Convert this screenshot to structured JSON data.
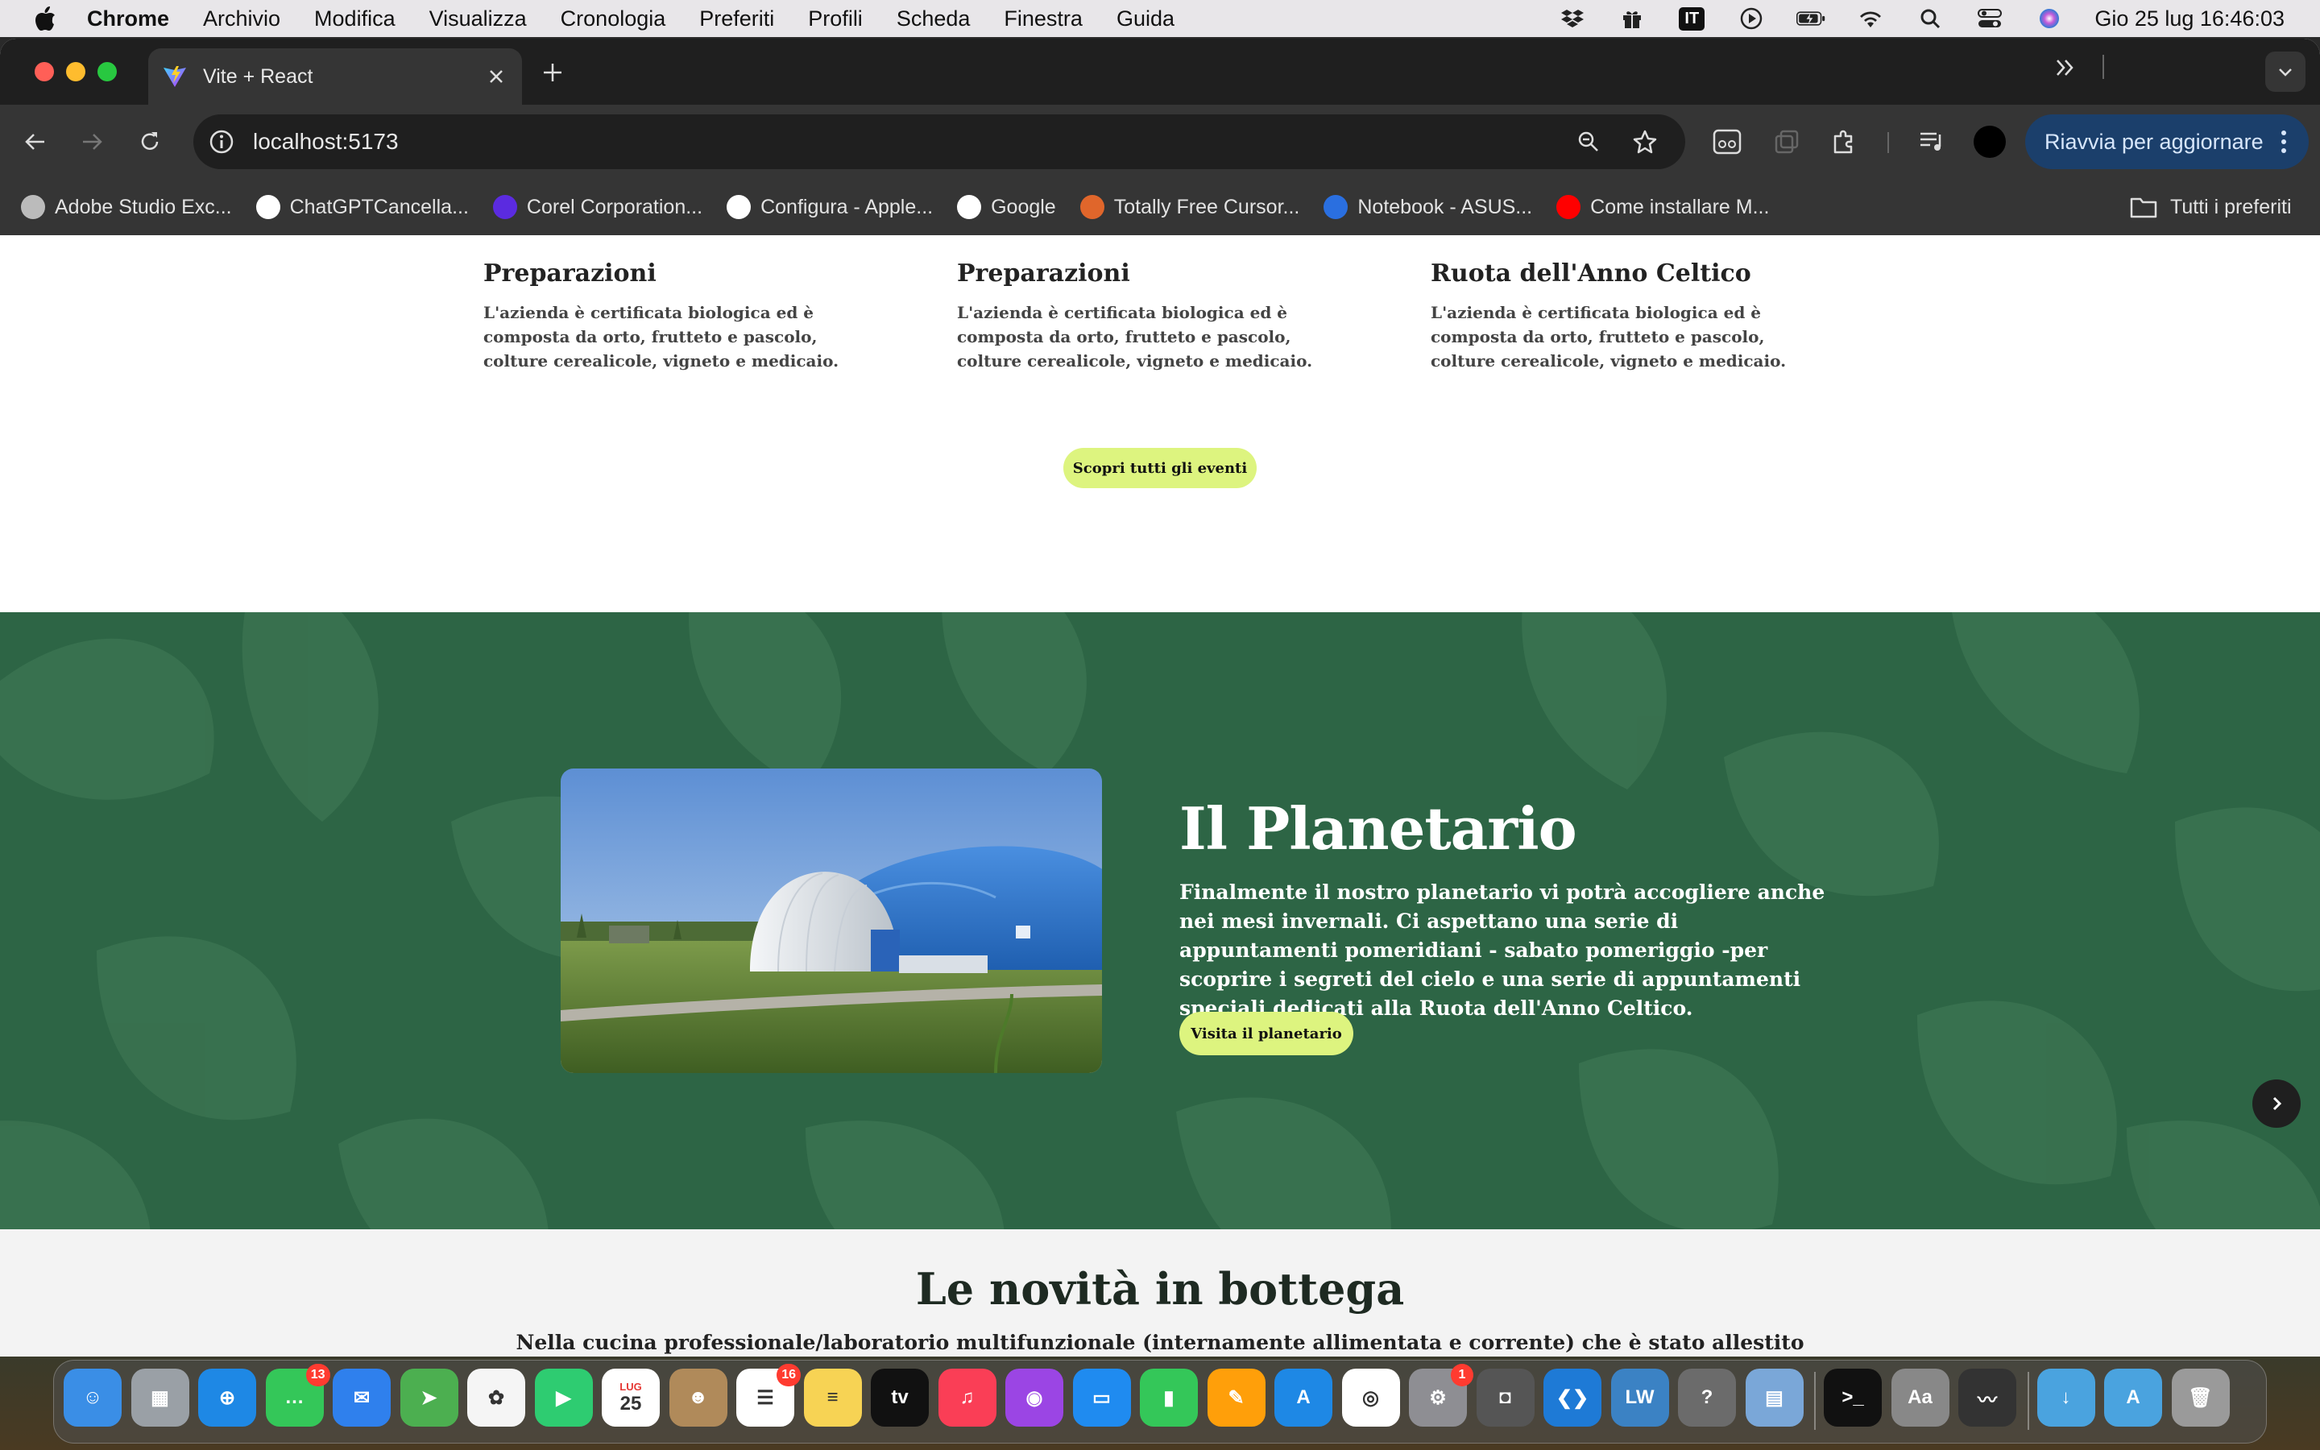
{
  "menubar": {
    "app_name": "Chrome",
    "items": [
      "Archivio",
      "Modifica",
      "Visualizza",
      "Cronologia",
      "Preferiti",
      "Profili",
      "Scheda",
      "Finestra",
      "Guida"
    ],
    "input_source": "IT",
    "clock": "Gio 25 lug  16:46:03"
  },
  "browser": {
    "tab_title": "Vite + React",
    "url": "localhost:5173",
    "relaunch_label": "Riavvia per aggiornare",
    "bookmarks": [
      {
        "label": "Adobe Studio Exc...",
        "icon": "globe-icon",
        "color": "#bbbbbb"
      },
      {
        "label": "ChatGPTCancella...",
        "icon": "chatgpt-icon",
        "color": "#ffffff"
      },
      {
        "label": "Corel Corporation...",
        "icon": "corel-icon",
        "color": "#5b2be0"
      },
      {
        "label": "Configura - Apple...",
        "icon": "apple-icon",
        "color": "#ffffff"
      },
      {
        "label": "Google",
        "icon": "google-icon",
        "color": "#ffffff"
      },
      {
        "label": "Totally Free Cursor...",
        "icon": "cursor-icon",
        "color": "#e0662b"
      },
      {
        "label": "Notebook - ASUS...",
        "icon": "asus-icon",
        "color": "#2a6fe0"
      },
      {
        "label": "Come installare M...",
        "icon": "youtube-icon",
        "color": "#ff0000"
      }
    ],
    "all_bookmarks_label": "Tutti i preferiti"
  },
  "page": {
    "events": [
      {
        "title": "Preparazioni",
        "text": "L'azienda è certificata biologica ed è composta da orto, frutteto e pascolo, colture cerealicole, vigneto e medicaio."
      },
      {
        "title": "Preparazioni",
        "text": "L'azienda è certificata biologica ed è composta da orto, frutteto e pascolo, colture cerealicole, vigneto e medicaio."
      },
      {
        "title": "Ruota dell'Anno Celtico",
        "text": "L'azienda è certificata biologica ed è composta da orto, frutteto e pascolo, colture cerealicole, vigneto e medicaio."
      }
    ],
    "events_button": "Scopri tutti gli eventi",
    "planetario": {
      "title": "Il Planetario",
      "text": "Finalmente il nostro planetario vi potrà accogliere anche nei mesi invernali. Ci aspettano una serie di appuntamenti pomeridiani - sabato pomeriggio -per scoprire i segreti del cielo e una serie di appuntamenti speciali dedicati alla Ruota dell'Anno Celtico.",
      "button": "Visita il planetario"
    },
    "bottega": {
      "title": "Le novità in bottega",
      "text": "Nella cucina professionale/laboratorio multifunzionale (internamente allimentata e corrente) che è stato allestito"
    }
  },
  "dock": {
    "apps": [
      {
        "name": "finder",
        "color": "#3a8ee6",
        "glyph": "☺"
      },
      {
        "name": "launchpad",
        "color": "#9aa0a6",
        "glyph": "▦"
      },
      {
        "name": "safari",
        "color": "#1e88e5",
        "glyph": "⊕"
      },
      {
        "name": "messages",
        "color": "#34c759",
        "glyph": "…",
        "badge": "13"
      },
      {
        "name": "mail",
        "color": "#2f80ed",
        "glyph": "✉"
      },
      {
        "name": "maps",
        "color": "#4caf50",
        "glyph": "➤"
      },
      {
        "name": "photos",
        "color": "#f5f5f5",
        "glyph": "✿"
      },
      {
        "name": "facetime",
        "color": "#2ecc71",
        "glyph": "▶"
      },
      {
        "name": "calendar",
        "color": "#ffffff",
        "glyph": "25",
        "caption": "LUG"
      },
      {
        "name": "contacts",
        "color": "#b08a5a",
        "glyph": "☻"
      },
      {
        "name": "reminders",
        "color": "#ffffff",
        "glyph": "☰",
        "badge": "16"
      },
      {
        "name": "notes",
        "color": "#f7d354",
        "glyph": "≡"
      },
      {
        "name": "apple-tv",
        "color": "#111111",
        "glyph": "tv"
      },
      {
        "name": "music",
        "color": "#fa3e56",
        "glyph": "♫"
      },
      {
        "name": "podcasts",
        "color": "#9b45e4",
        "glyph": "◉"
      },
      {
        "name": "keynote",
        "color": "#1f8bf0",
        "glyph": "▭"
      },
      {
        "name": "numbers",
        "color": "#34c759",
        "glyph": "▮"
      },
      {
        "name": "pages",
        "color": "#ff9f0a",
        "glyph": "✎"
      },
      {
        "name": "app-store",
        "color": "#1e88e5",
        "glyph": "A"
      },
      {
        "name": "chrome",
        "color": "#ffffff",
        "glyph": "◎"
      },
      {
        "name": "system-settings",
        "color": "#8e8e93",
        "glyph": "⚙",
        "badge": "1"
      },
      {
        "name": "screenshot",
        "color": "#555555",
        "glyph": "◘"
      },
      {
        "name": "vscode",
        "color": "#1e7ad6",
        "glyph": "❮❯"
      },
      {
        "name": "lw",
        "color": "#3b82c4",
        "glyph": "LW"
      },
      {
        "name": "help",
        "color": "#6b6b6b",
        "glyph": "?"
      },
      {
        "name": "preview",
        "color": "#7aa7d8",
        "glyph": "▤"
      },
      {
        "name": "terminal",
        "color": "#111111",
        "glyph": ">_"
      },
      {
        "name": "font-book",
        "color": "#888888",
        "glyph": "Aa"
      },
      {
        "name": "voice-memos",
        "color": "#333333",
        "glyph": "〰"
      },
      {
        "name": "downloads-folder",
        "color": "#4aa3df",
        "glyph": "↓"
      },
      {
        "name": "applications-folder",
        "color": "#4aa3df",
        "glyph": "A"
      },
      {
        "name": "trash",
        "color": "#9a9a9a",
        "glyph": "🗑"
      }
    ]
  }
}
